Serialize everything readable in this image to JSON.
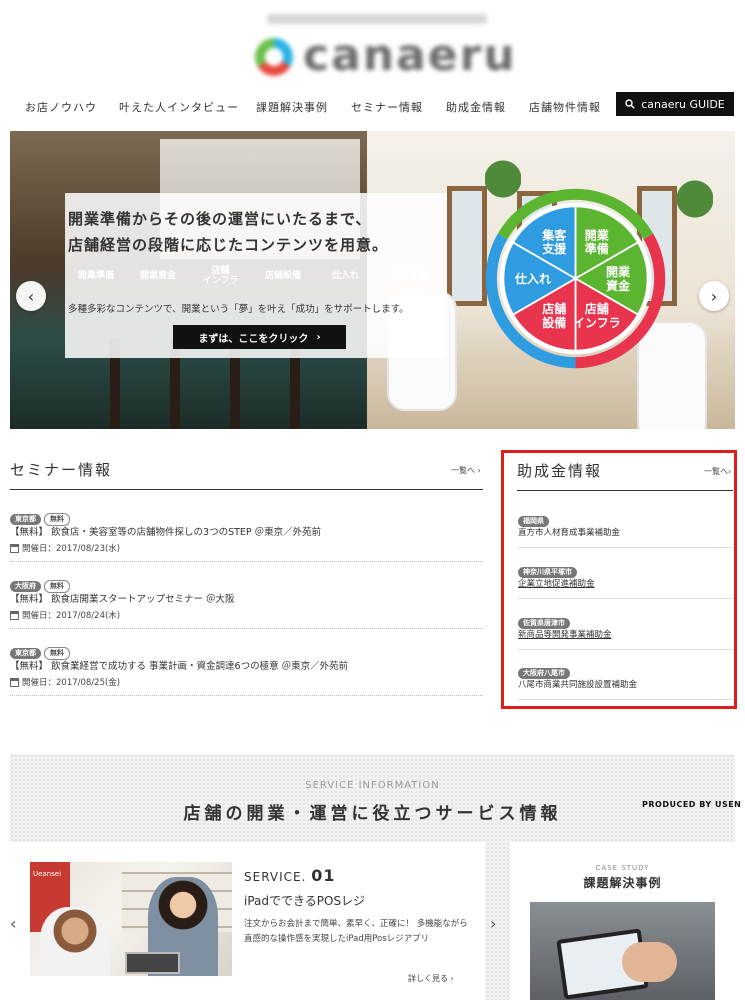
{
  "header": {
    "logo_text": "canaeru",
    "nav": [
      {
        "label": "お店ノウハウ"
      },
      {
        "label": "叶えた人インタビュー"
      },
      {
        "label": "課題解決事例"
      },
      {
        "label": "セミナー情報"
      },
      {
        "label": "助成金情報"
      },
      {
        "label": "店舗物件情報"
      }
    ],
    "guide_label": "canaeru GUIDE"
  },
  "hero": {
    "line1": "開業準備からその後の運営にいたるまで、",
    "line2": "店舗経営の段階に応じたコンテンツを用意。",
    "chips": [
      {
        "label": "開業準備",
        "color": "#5cb531"
      },
      {
        "label": "開業資金",
        "color": "#5cb531"
      },
      {
        "label": "店舗\nインフラ",
        "color": "#e9344e"
      },
      {
        "label": "店舗設備",
        "color": "#e9344e"
      },
      {
        "label": "仕入れ",
        "color": "#2f9be0"
      },
      {
        "label": "集客支援",
        "color": "#2f9be0"
      }
    ],
    "desc": "多種多彩なコンテンツで、開業という「夢」を叶え「成功」をサポートします。",
    "cta_label": "まずは、ここをクリック",
    "wheel": [
      {
        "label": "開業\n準備",
        "color": "#5cb531"
      },
      {
        "label": "開業\n資金",
        "color": "#5cb531"
      },
      {
        "label": "店舗\nインフラ",
        "color": "#e9344e"
      },
      {
        "label": "店舗\n設備",
        "color": "#e9344e"
      },
      {
        "label": "仕入れ",
        "color": "#2f9be0"
      },
      {
        "label": "集客\n支援",
        "color": "#2f9be0"
      }
    ]
  },
  "seminar": {
    "title": "セミナー情報",
    "more": "一覧へ",
    "items": [
      {
        "area": "東京都",
        "tag": "無料",
        "title": "【無料】 飲食店・美容室等の店舗物件探しの3つのSTEP ＠東京／外苑前",
        "date": "開催日：2017/08/23(水)"
      },
      {
        "area": "大阪府",
        "tag": "無料",
        "title": "【無料】 飲食店開業スタートアップセミナー ＠大阪",
        "date": "開催日：2017/08/24(木)"
      },
      {
        "area": "東京都",
        "tag": "無料",
        "title": "【無料】 飲食業経営で成功する 事業計画・資金調達6つの極意 ＠東京／外苑前",
        "date": "開催日：2017/08/25(金)"
      }
    ]
  },
  "grant": {
    "title": "助成金情報",
    "more": "一覧へ",
    "items": [
      {
        "area": "福岡県",
        "name": "直方市人材育成事業補助金"
      },
      {
        "area": "神奈川県平塚市",
        "name": "企業立地促進補助金"
      },
      {
        "area": "佐賀県唐津市",
        "name": "新商品等開発事業補助金"
      },
      {
        "area": "大阪府八尾市",
        "name": "八尾市商業共同施設設置補助金"
      }
    ]
  },
  "service": {
    "eyebrow": "SERVICE INFORMATION",
    "heading": "店舗の開業・運営に役立つサービス情報",
    "produced_by": "PRODUCED BY USEN",
    "card": {
      "kicker": "SERVICE.",
      "number": "01",
      "title": "iPadでできるPOSレジ",
      "desc": "注文からお会計まで簡単、素早く、正確に！ 多機能ながら直感的な操作感を実現したiPad用Posレジアプリ",
      "details": "詳しく見る",
      "photo_sign": "Ueansei"
    },
    "case": {
      "eyebrow": "CASE STUDY",
      "title": "課題解決事例"
    }
  }
}
